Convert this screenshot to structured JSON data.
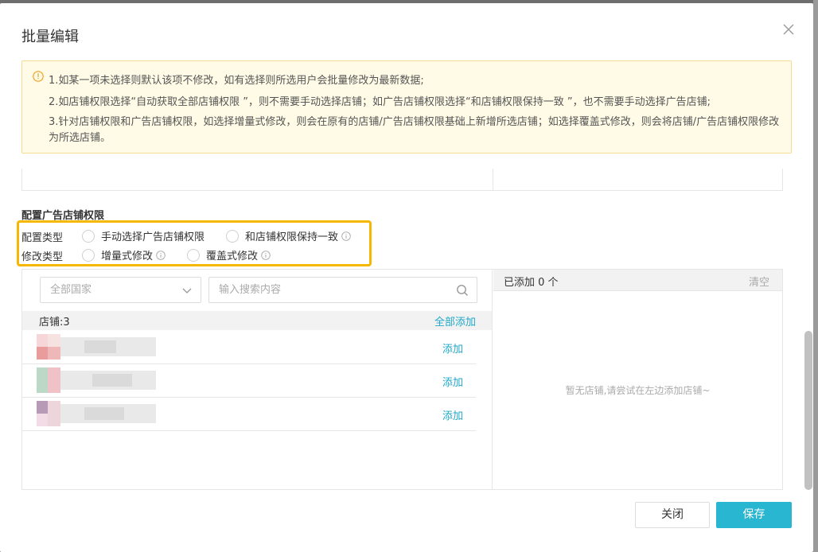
{
  "dialog": {
    "title": "批量编辑"
  },
  "notice": {
    "line1": "1.如某一项未选择则默认该项不修改，如有选择则所选用户会批量修改为最新数据;",
    "line2": "2.如店铺权限选择“自动获取全部店铺权限 ”，则不需要手动选择店铺；如广告店铺权限选择“和店铺权限保持一致 ”，也不需要手动选择广告店铺;",
    "line3": "3.针对店铺权限和广告店铺权限，如选择增量式修改，则会在原有的店铺/广告店铺权限基础上新增所选店铺；如选择覆盖式修改，则会将店铺/广告店铺权限修改为所选店铺。"
  },
  "section": {
    "title": "配置广告店铺权限"
  },
  "config": {
    "type_label": "配置类型",
    "type_options": [
      "手动选择广告店铺权限",
      "和店铺权限保持一致"
    ],
    "mode_label": "修改类型",
    "mode_options": [
      "增量式修改",
      "覆盖式修改"
    ]
  },
  "filter": {
    "country_select": "全部国家",
    "search_placeholder": "输入搜索内容"
  },
  "left_list": {
    "count_label": "店铺:3",
    "add_all": "全部添加",
    "rows": [
      {
        "add": "添加"
      },
      {
        "add": "添加"
      },
      {
        "add": "添加"
      }
    ]
  },
  "right_list": {
    "added_label": "已添加 0 个",
    "clear": "清空",
    "empty": "暂无店铺,请尝试在左边添加店铺~"
  },
  "footer": {
    "close": "关闭",
    "save": "保存"
  },
  "colors": {
    "accent": "#29b6d1",
    "link": "#20a8c8",
    "highlight_border": "#f5b700",
    "notice_bg": "#fffbe6"
  }
}
